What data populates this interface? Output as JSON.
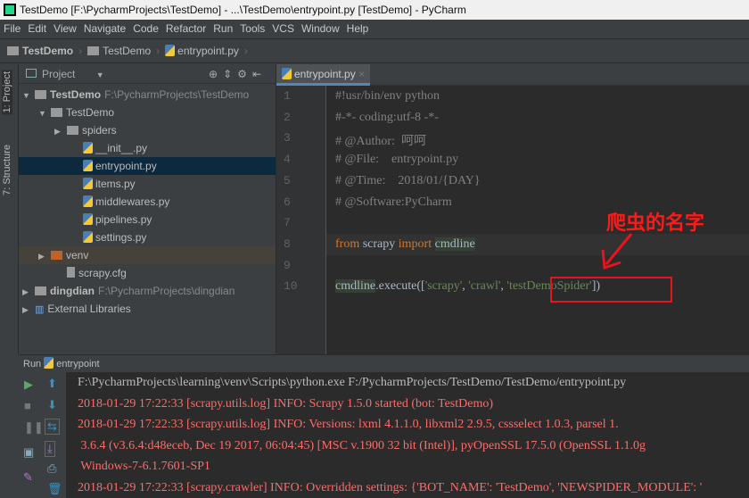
{
  "window": {
    "title": "TestDemo [F:\\PycharmProjects\\TestDemo] - ...\\TestDemo\\entrypoint.py [TestDemo] - PyCharm"
  },
  "menu": [
    "File",
    "Edit",
    "View",
    "Navigate",
    "Code",
    "Refactor",
    "Run",
    "Tools",
    "VCS",
    "Window",
    "Help"
  ],
  "breadcrumb": [
    "TestDemo",
    "TestDemo",
    "entrypoint.py"
  ],
  "tool_strip": {
    "project": "1: Project",
    "structure": "7: Structure"
  },
  "project": {
    "header": "Project",
    "tree": [
      {
        "label": "TestDemo",
        "path": "F:\\PycharmProjects\\TestDemo",
        "level": 0,
        "type": "folder",
        "expanded": true,
        "bold": true
      },
      {
        "label": "TestDemo",
        "level": 1,
        "type": "package",
        "expanded": true
      },
      {
        "label": "spiders",
        "level": 2,
        "type": "package",
        "expanded": false
      },
      {
        "label": "__init__.py",
        "level": 3,
        "type": "py"
      },
      {
        "label": "entrypoint.py",
        "level": 3,
        "type": "py",
        "selected": true
      },
      {
        "label": "items.py",
        "level": 3,
        "type": "py"
      },
      {
        "label": "middlewares.py",
        "level": 3,
        "type": "py"
      },
      {
        "label": "pipelines.py",
        "level": 3,
        "type": "py"
      },
      {
        "label": "settings.py",
        "level": 3,
        "type": "py"
      },
      {
        "label": "venv",
        "level": 1,
        "type": "venv",
        "expanded": false
      },
      {
        "label": "scrapy.cfg",
        "level": 2,
        "type": "file"
      },
      {
        "label": "dingdian",
        "path": "F:\\PycharmProjects\\dingdian",
        "level": 0,
        "type": "folder",
        "expanded": false,
        "bold": true
      },
      {
        "label": "External Libraries",
        "level": 0,
        "type": "lib",
        "expanded": false
      }
    ]
  },
  "editor": {
    "tab": "entrypoint.py",
    "lines": {
      "l1": "#!usr/bin/env python",
      "l2": "#-*- coding:utf-8 -*-",
      "l3": "# @Author:  呵呵",
      "l4": "# @File:    entrypoint.py",
      "l5": "# @Time:    2018/01/{DAY}",
      "l6": "# @Software:PyCharm",
      "l8a": "from",
      "l8b": " scrapy ",
      "l8c": "import",
      "l8d": "cmdline",
      "l10a": "cmdline",
      ".": ".",
      "l10b": ".execute([",
      "l10c": "'scrapy'",
      "l10d": ", ",
      "l10e": "'crawl'",
      "l10f": ", ",
      "l10g": "'testDemoSpider'",
      "l10h": "])"
    },
    "annotation": "爬虫的名字"
  },
  "run": {
    "label": "Run",
    "config": "entrypoint",
    "console": [
      "F:\\PycharmProjects\\learning\\venv\\Scripts\\python.exe F:/PycharmProjects/TestDemo/TestDemo/entrypoint.py",
      "2018-01-29 17:22:33 [scrapy.utils.log] INFO: Scrapy 1.5.0 started (bot: TestDemo)",
      "2018-01-29 17:22:33 [scrapy.utils.log] INFO: Versions: lxml 4.1.1.0, libxml2 2.9.5, cssselect 1.0.3, parsel 1.",
      " 3.6.4 (v3.6.4:d48eceb, Dec 19 2017, 06:04:45) [MSC v.1900 32 bit (Intel)], pyOpenSSL 17.5.0 (OpenSSL 1.1.0g",
      " Windows-7-6.1.7601-SP1",
      "2018-01-29 17:22:33 [scrapy.crawler] INFO: Overridden settings: {'BOT_NAME': 'TestDemo', 'NEWSPIDER_MODULE': '"
    ]
  },
  "colors": {
    "accent": "#4a88c7",
    "annotation": "#e8141c",
    "console_error": "#ff6b68",
    "keyword": "#cc7832",
    "string": "#6a8759"
  }
}
